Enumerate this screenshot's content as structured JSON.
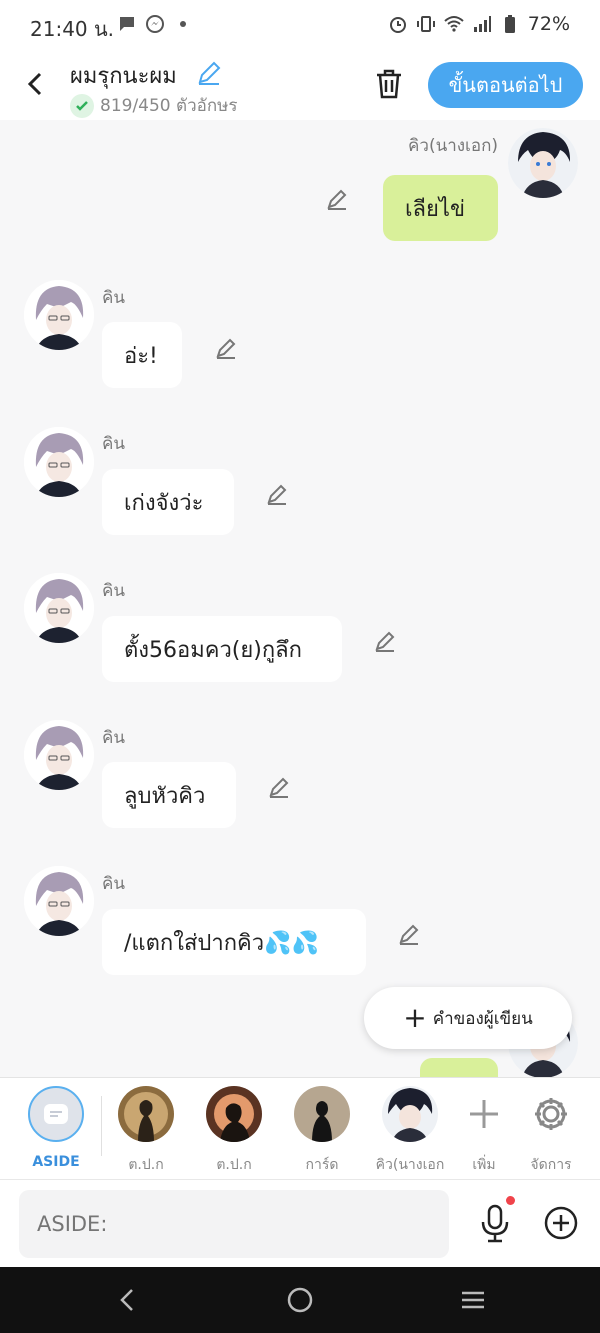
{
  "status_bar": {
    "time": "21:40 น.",
    "battery": "72%"
  },
  "header": {
    "title": "ผมรุกนะผม",
    "char_count": "819/450 ตัวอักษร",
    "next_button": "ขั้นตอนต่อไป"
  },
  "messages": [
    {
      "speaker": "คิว(นางเอก)",
      "text": "เลียไข่",
      "side": "right"
    },
    {
      "speaker": "คิน",
      "text": "อ่ะ!",
      "side": "left"
    },
    {
      "speaker": "คิน",
      "text": "เก่งจังว่ะ",
      "side": "left"
    },
    {
      "speaker": "คิน",
      "text": "ตั้ง56อมคว(ย)กูลึก",
      "side": "left"
    },
    {
      "speaker": "คิน",
      "text": "ลูบหัวคิว",
      "side": "left"
    },
    {
      "speaker": "คิน",
      "text": "/แตกใส่ปากคิว💦💦",
      "side": "left"
    }
  ],
  "author_note_button": "คำของผู้เขียน",
  "character_bar": {
    "items": [
      {
        "label": "ASIDE",
        "icon": "aside-icon",
        "selected": true
      },
      {
        "label": "ต.ป.ก"
      },
      {
        "label": "ต.ป.ก"
      },
      {
        "label": "การ์ด"
      },
      {
        "label": "คิว(นางเอก"
      },
      {
        "label": "เพิ่ม",
        "icon": "plus-icon"
      },
      {
        "label": "จัดการ",
        "icon": "gear-icon"
      }
    ]
  },
  "composer": {
    "placeholder": "ASIDE:"
  },
  "colors": {
    "accent": "#4aa7f0",
    "my_bubble": "#d9f09a",
    "background": "#f7f7f8"
  }
}
